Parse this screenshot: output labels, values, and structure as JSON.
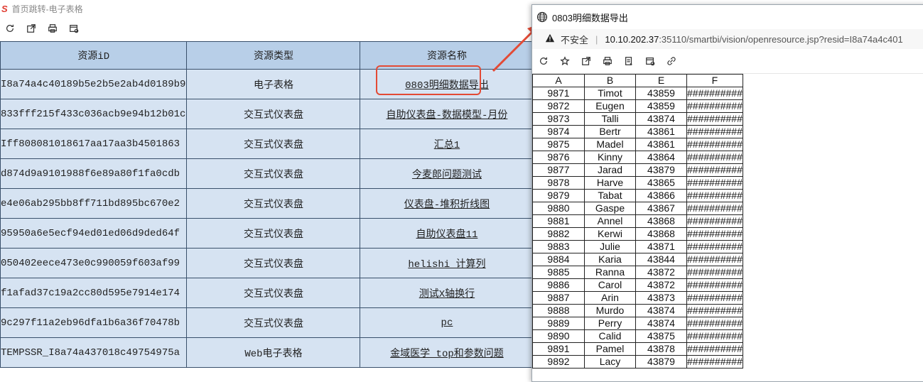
{
  "left": {
    "title": "首页跳转-电子表格",
    "logo": "S",
    "toolbar": {
      "refresh": "refresh-icon",
      "open": "open-external-icon",
      "print": "print-icon",
      "settings": "settings-icon"
    },
    "table": {
      "headers": [
        "资源iD",
        "资源类型",
        "资源名称"
      ],
      "rows": [
        {
          "id": "I8a74a4c40189b5e2b5e2ab4d0189b9",
          "type": "电子表格",
          "name": "0803明细数据导出"
        },
        {
          "id": "833fff215f433c036acb9e94b12b01c",
          "type": "交互式仪表盘",
          "name": "自助仪表盘-数据模型-月份"
        },
        {
          "id": "Iff808081018617aa17aa3b4501863",
          "type": "交互式仪表盘",
          "name": "汇总1"
        },
        {
          "id": "d874d9a9101988f6e89a80f1fa0cdb",
          "type": "交互式仪表盘",
          "name": "今麦郎问题测试"
        },
        {
          "id": "e4e06ab295bb8ff711bd895bc670e2",
          "type": "交互式仪表盘",
          "name": "仪表盘-堆积折线图"
        },
        {
          "id": "95950a6e5ecf94ed01ed06d9ded64f",
          "type": "交互式仪表盘",
          "name": "自助仪表盘11"
        },
        {
          "id": "050402eece473e0c990059f603af99",
          "type": "交互式仪表盘",
          "name": "helishi 计算列"
        },
        {
          "id": "f1afad37c19a2cc80d595e7914e174",
          "type": "交互式仪表盘",
          "name": "测试X轴换行"
        },
        {
          "id": "9c297f11a2eb96dfa1b6a36f70478b",
          "type": "交互式仪表盘",
          "name": "pc"
        },
        {
          "id": "TEMPSSR_I8a74a437018c49754975a",
          "type": "Web电子表格",
          "name": "金域医学 top和参数问题"
        }
      ]
    },
    "accent_color": "#e34a35"
  },
  "popup": {
    "title": "0803明细数据导出",
    "address": {
      "security": "不安全",
      "host": "10.10.202.37",
      "rest": ":35110/smartbi/vision/openresource.jsp?resid=I8a74a4c401"
    },
    "sheet": {
      "headers": [
        "A",
        "B",
        "E",
        "F"
      ],
      "rows": [
        [
          "9871",
          "Timot",
          "43859",
          "##########"
        ],
        [
          "9872",
          "Eugen",
          "43859",
          "##########"
        ],
        [
          "9873",
          "Talli",
          "43874",
          "##########"
        ],
        [
          "9874",
          "Bertr",
          "43861",
          "##########"
        ],
        [
          "9875",
          "Madel",
          "43861",
          "##########"
        ],
        [
          "9876",
          "Kinny",
          "43864",
          "##########"
        ],
        [
          "9877",
          "Jarad",
          "43879",
          "##########"
        ],
        [
          "9878",
          "Harve",
          "43865",
          "##########"
        ],
        [
          "9879",
          "Tabat",
          "43866",
          "##########"
        ],
        [
          "9880",
          "Gaspe",
          "43867",
          "##########"
        ],
        [
          "9881",
          "Annel",
          "43868",
          "##########"
        ],
        [
          "9882",
          "Kerwi",
          "43868",
          "##########"
        ],
        [
          "9883",
          "Julie",
          "43871",
          "##########"
        ],
        [
          "9884",
          "Karia",
          "43844",
          "##########"
        ],
        [
          "9885",
          "Ranna",
          "43872",
          "##########"
        ],
        [
          "9886",
          "Carol",
          "43872",
          "##########"
        ],
        [
          "9887",
          "Arin",
          "43873",
          "##########"
        ],
        [
          "9888",
          "Murdo",
          "43874",
          "##########"
        ],
        [
          "9889",
          "Perry",
          "43874",
          "##########"
        ],
        [
          "9890",
          "Calid",
          "43875",
          "##########"
        ],
        [
          "9891",
          "Pamel",
          "43878",
          "##########"
        ],
        [
          "9892",
          "Lacy",
          "43879",
          "##########"
        ]
      ]
    }
  }
}
